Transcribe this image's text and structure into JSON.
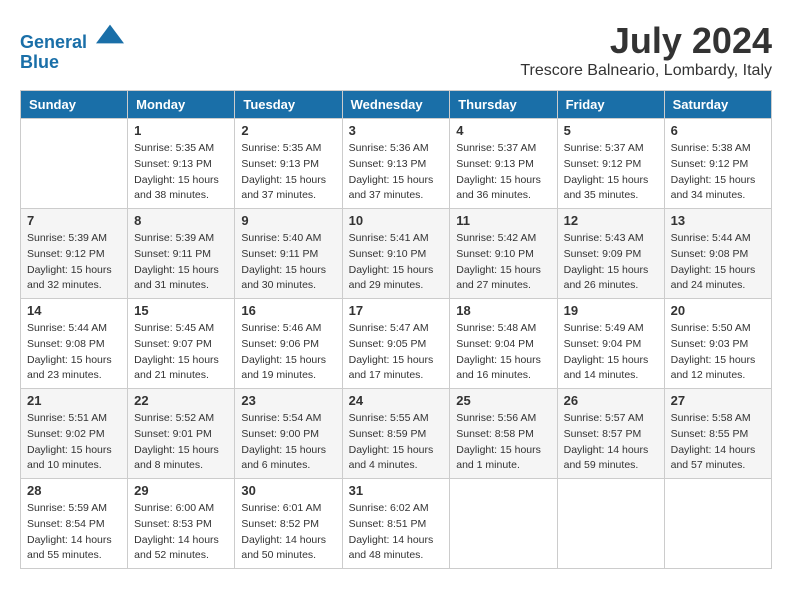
{
  "logo": {
    "line1": "General",
    "line2": "Blue"
  },
  "title": "July 2024",
  "location": "Trescore Balneario, Lombardy, Italy",
  "days_of_week": [
    "Sunday",
    "Monday",
    "Tuesday",
    "Wednesday",
    "Thursday",
    "Friday",
    "Saturday"
  ],
  "weeks": [
    [
      {
        "day": "",
        "sunrise": "",
        "sunset": "",
        "daylight": ""
      },
      {
        "day": "1",
        "sunrise": "Sunrise: 5:35 AM",
        "sunset": "Sunset: 9:13 PM",
        "daylight": "Daylight: 15 hours and 38 minutes."
      },
      {
        "day": "2",
        "sunrise": "Sunrise: 5:35 AM",
        "sunset": "Sunset: 9:13 PM",
        "daylight": "Daylight: 15 hours and 37 minutes."
      },
      {
        "day": "3",
        "sunrise": "Sunrise: 5:36 AM",
        "sunset": "Sunset: 9:13 PM",
        "daylight": "Daylight: 15 hours and 37 minutes."
      },
      {
        "day": "4",
        "sunrise": "Sunrise: 5:37 AM",
        "sunset": "Sunset: 9:13 PM",
        "daylight": "Daylight: 15 hours and 36 minutes."
      },
      {
        "day": "5",
        "sunrise": "Sunrise: 5:37 AM",
        "sunset": "Sunset: 9:12 PM",
        "daylight": "Daylight: 15 hours and 35 minutes."
      },
      {
        "day": "6",
        "sunrise": "Sunrise: 5:38 AM",
        "sunset": "Sunset: 9:12 PM",
        "daylight": "Daylight: 15 hours and 34 minutes."
      }
    ],
    [
      {
        "day": "7",
        "sunrise": "Sunrise: 5:39 AM",
        "sunset": "Sunset: 9:12 PM",
        "daylight": "Daylight: 15 hours and 32 minutes."
      },
      {
        "day": "8",
        "sunrise": "Sunrise: 5:39 AM",
        "sunset": "Sunset: 9:11 PM",
        "daylight": "Daylight: 15 hours and 31 minutes."
      },
      {
        "day": "9",
        "sunrise": "Sunrise: 5:40 AM",
        "sunset": "Sunset: 9:11 PM",
        "daylight": "Daylight: 15 hours and 30 minutes."
      },
      {
        "day": "10",
        "sunrise": "Sunrise: 5:41 AM",
        "sunset": "Sunset: 9:10 PM",
        "daylight": "Daylight: 15 hours and 29 minutes."
      },
      {
        "day": "11",
        "sunrise": "Sunrise: 5:42 AM",
        "sunset": "Sunset: 9:10 PM",
        "daylight": "Daylight: 15 hours and 27 minutes."
      },
      {
        "day": "12",
        "sunrise": "Sunrise: 5:43 AM",
        "sunset": "Sunset: 9:09 PM",
        "daylight": "Daylight: 15 hours and 26 minutes."
      },
      {
        "day": "13",
        "sunrise": "Sunrise: 5:44 AM",
        "sunset": "Sunset: 9:08 PM",
        "daylight": "Daylight: 15 hours and 24 minutes."
      }
    ],
    [
      {
        "day": "14",
        "sunrise": "Sunrise: 5:44 AM",
        "sunset": "Sunset: 9:08 PM",
        "daylight": "Daylight: 15 hours and 23 minutes."
      },
      {
        "day": "15",
        "sunrise": "Sunrise: 5:45 AM",
        "sunset": "Sunset: 9:07 PM",
        "daylight": "Daylight: 15 hours and 21 minutes."
      },
      {
        "day": "16",
        "sunrise": "Sunrise: 5:46 AM",
        "sunset": "Sunset: 9:06 PM",
        "daylight": "Daylight: 15 hours and 19 minutes."
      },
      {
        "day": "17",
        "sunrise": "Sunrise: 5:47 AM",
        "sunset": "Sunset: 9:05 PM",
        "daylight": "Daylight: 15 hours and 17 minutes."
      },
      {
        "day": "18",
        "sunrise": "Sunrise: 5:48 AM",
        "sunset": "Sunset: 9:04 PM",
        "daylight": "Daylight: 15 hours and 16 minutes."
      },
      {
        "day": "19",
        "sunrise": "Sunrise: 5:49 AM",
        "sunset": "Sunset: 9:04 PM",
        "daylight": "Daylight: 15 hours and 14 minutes."
      },
      {
        "day": "20",
        "sunrise": "Sunrise: 5:50 AM",
        "sunset": "Sunset: 9:03 PM",
        "daylight": "Daylight: 15 hours and 12 minutes."
      }
    ],
    [
      {
        "day": "21",
        "sunrise": "Sunrise: 5:51 AM",
        "sunset": "Sunset: 9:02 PM",
        "daylight": "Daylight: 15 hours and 10 minutes."
      },
      {
        "day": "22",
        "sunrise": "Sunrise: 5:52 AM",
        "sunset": "Sunset: 9:01 PM",
        "daylight": "Daylight: 15 hours and 8 minutes."
      },
      {
        "day": "23",
        "sunrise": "Sunrise: 5:54 AM",
        "sunset": "Sunset: 9:00 PM",
        "daylight": "Daylight: 15 hours and 6 minutes."
      },
      {
        "day": "24",
        "sunrise": "Sunrise: 5:55 AM",
        "sunset": "Sunset: 8:59 PM",
        "daylight": "Daylight: 15 hours and 4 minutes."
      },
      {
        "day": "25",
        "sunrise": "Sunrise: 5:56 AM",
        "sunset": "Sunset: 8:58 PM",
        "daylight": "Daylight: 15 hours and 1 minute."
      },
      {
        "day": "26",
        "sunrise": "Sunrise: 5:57 AM",
        "sunset": "Sunset: 8:57 PM",
        "daylight": "Daylight: 14 hours and 59 minutes."
      },
      {
        "day": "27",
        "sunrise": "Sunrise: 5:58 AM",
        "sunset": "Sunset: 8:55 PM",
        "daylight": "Daylight: 14 hours and 57 minutes."
      }
    ],
    [
      {
        "day": "28",
        "sunrise": "Sunrise: 5:59 AM",
        "sunset": "Sunset: 8:54 PM",
        "daylight": "Daylight: 14 hours and 55 minutes."
      },
      {
        "day": "29",
        "sunrise": "Sunrise: 6:00 AM",
        "sunset": "Sunset: 8:53 PM",
        "daylight": "Daylight: 14 hours and 52 minutes."
      },
      {
        "day": "30",
        "sunrise": "Sunrise: 6:01 AM",
        "sunset": "Sunset: 8:52 PM",
        "daylight": "Daylight: 14 hours and 50 minutes."
      },
      {
        "day": "31",
        "sunrise": "Sunrise: 6:02 AM",
        "sunset": "Sunset: 8:51 PM",
        "daylight": "Daylight: 14 hours and 48 minutes."
      },
      {
        "day": "",
        "sunrise": "",
        "sunset": "",
        "daylight": ""
      },
      {
        "day": "",
        "sunrise": "",
        "sunset": "",
        "daylight": ""
      },
      {
        "day": "",
        "sunrise": "",
        "sunset": "",
        "daylight": ""
      }
    ]
  ]
}
